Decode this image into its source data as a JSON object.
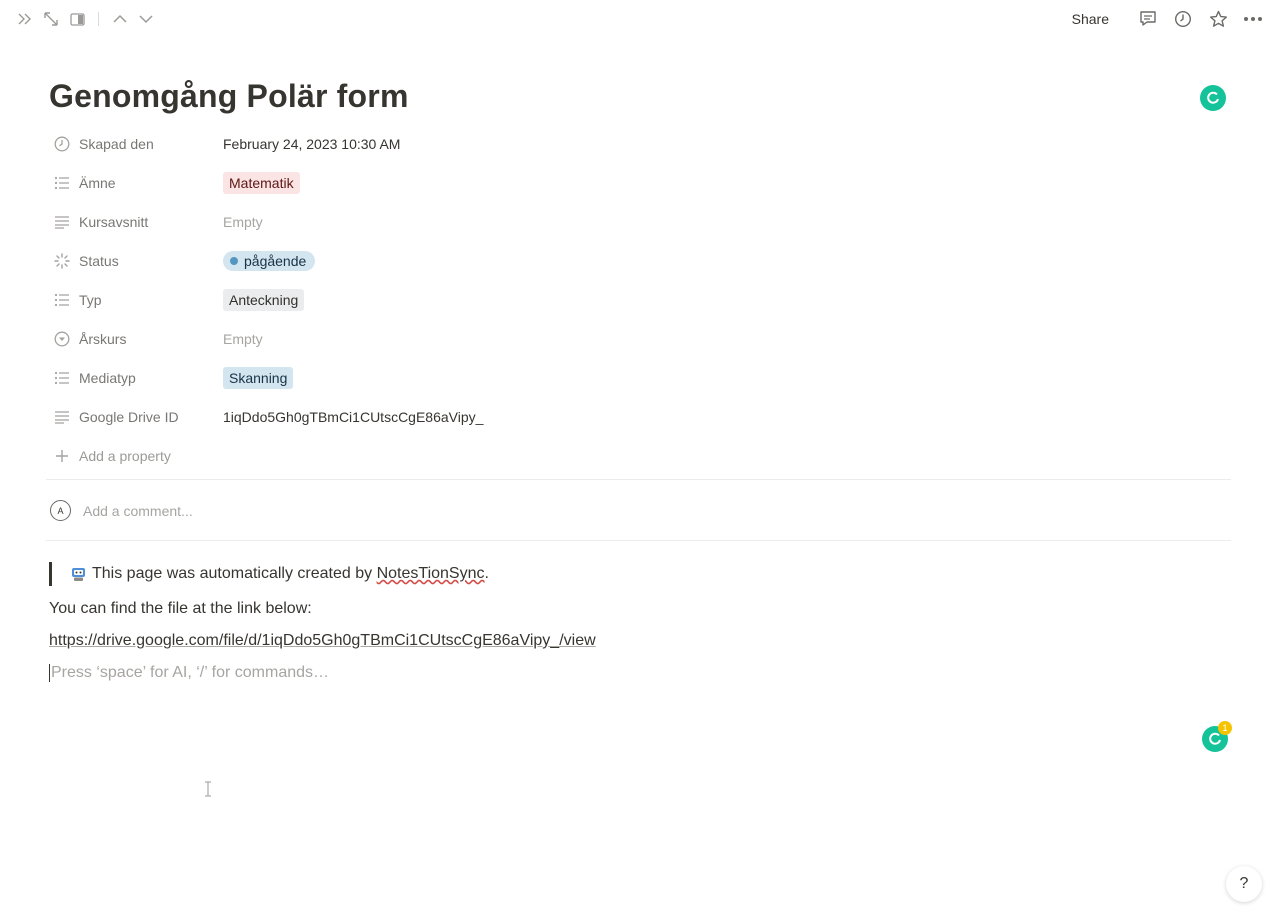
{
  "topbar": {
    "share_label": "Share"
  },
  "page": {
    "title": "Genomgång Polär form"
  },
  "properties": [
    {
      "name": "Skapad den",
      "icon": "clock-icon",
      "value": "February 24, 2023 10:30 AM",
      "kind": "text"
    },
    {
      "name": "Ämne",
      "icon": "list-icon",
      "value": "Matematik",
      "kind": "tag",
      "color": "#fbe4e4"
    },
    {
      "name": "Kursavsnitt",
      "icon": "text-lines-icon",
      "value": "Empty",
      "kind": "empty"
    },
    {
      "name": "Status",
      "icon": "status-spinner-icon",
      "value": "pågående",
      "kind": "status",
      "color": "#5596c1"
    },
    {
      "name": "Typ",
      "icon": "list-icon",
      "value": "Anteckning",
      "kind": "tag",
      "color": "#ebeced"
    },
    {
      "name": "Årskurs",
      "icon": "select-icon",
      "value": "Empty",
      "kind": "empty"
    },
    {
      "name": "Mediatyp",
      "icon": "list-icon",
      "value": "Skanning",
      "kind": "tag",
      "color": "#d3e5ef"
    },
    {
      "name": "Google Drive ID",
      "icon": "text-lines-icon",
      "value": "1iqDdo5Gh0gTBmCi1CUtscCgE86aVipy_",
      "kind": "text"
    }
  ],
  "add_property_label": "Add a property",
  "comment": {
    "avatar_letter": "A",
    "placeholder": "Add a comment..."
  },
  "content": {
    "quote_prefix": "This page was automatically created by ",
    "quote_brand": "NotesTionSync",
    "quote_suffix": ".",
    "paragraph": "You can find the file at the link below:",
    "link": "https://drive.google.com/file/d/1iqDdo5Gh0gTBmCi1CUtscCgE86aVipy_/view",
    "placeholder": "Press ‘space’ for AI, ‘/’ for commands…"
  },
  "grammarly": {
    "badge_count": "1",
    "color": "#15c39a"
  },
  "help_label": "?"
}
